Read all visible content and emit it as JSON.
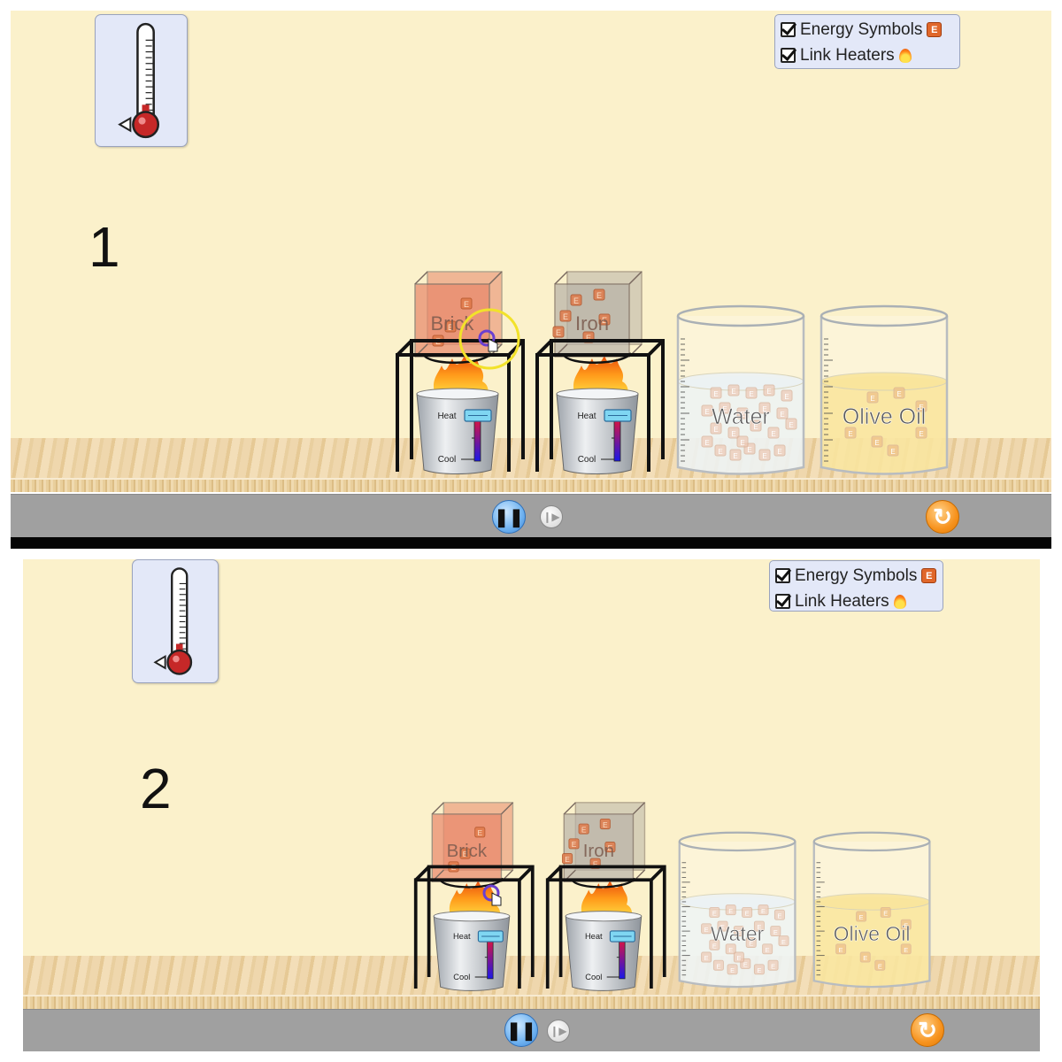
{
  "panels": [
    {
      "number": "1",
      "checkboxes": [
        {
          "label": "Energy Symbols",
          "checked": true,
          "icon": "energy-chunk-icon"
        },
        {
          "label": "Link Heaters",
          "checked": true,
          "icon": "flame-icon"
        }
      ],
      "blocks": [
        {
          "label": "Brick",
          "color": "#e8876a"
        },
        {
          "label": "Iron",
          "color": "#b8b2a8"
        }
      ],
      "heater": {
        "heat_label": "Heat",
        "cool_label": "Cool"
      },
      "beakers": [
        {
          "label": "Water",
          "color": "#e6eef0"
        },
        {
          "label": "Olive Oil",
          "color": "#f7dc7a"
        }
      ],
      "energy_symbol": "E",
      "controls": {
        "pause": "pause-icon",
        "step": "step-icon",
        "reset": "reset-icon"
      }
    },
    {
      "number": "2",
      "checkboxes": [
        {
          "label": "Energy Symbols",
          "checked": true,
          "icon": "energy-chunk-icon"
        },
        {
          "label": "Link Heaters",
          "checked": true,
          "icon": "flame-icon"
        }
      ],
      "blocks": [
        {
          "label": "Brick",
          "color": "#e8876a"
        },
        {
          "label": "Iron",
          "color": "#b8b2a8"
        }
      ],
      "heater": {
        "heat_label": "Heat",
        "cool_label": "Cool"
      },
      "beakers": [
        {
          "label": "Water",
          "color": "#e6eef0"
        },
        {
          "label": "Olive Oil",
          "color": "#f7dc7a"
        }
      ],
      "energy_symbol": "E",
      "controls": {
        "pause": "pause-icon",
        "step": "step-icon",
        "reset": "reset-icon"
      }
    }
  ]
}
